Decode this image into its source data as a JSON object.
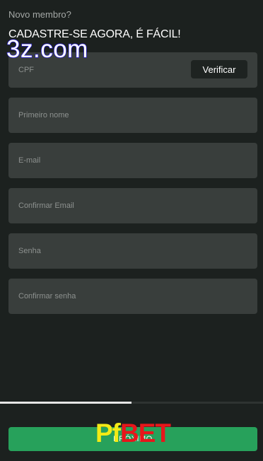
{
  "header": {
    "subtitle": "Novo membro?",
    "title": "CADASTRE-SE AGORA, É FÁCIL!"
  },
  "watermark": {
    "text": "3z.com"
  },
  "form": {
    "cpf_placeholder": "CPF",
    "verify_label": "Verificar",
    "first_name_placeholder": "Primeiro nome",
    "email_placeholder": "E-mail",
    "confirm_email_placeholder": "Confirmar Email",
    "password_placeholder": "Senha",
    "confirm_password_placeholder": "Confirmar senha"
  },
  "progress": {
    "fraction": 0.5
  },
  "footer": {
    "next_label": "PRÓXIMO"
  },
  "logo": {
    "part1": "Pf",
    "part2": "BET"
  },
  "colors": {
    "background": "#1c211f",
    "field": "#393e3c",
    "accent_green": "#27a15b",
    "logo_yellow": "#f3ea15",
    "logo_red": "#e8161b",
    "watermark_stroke": "#2a1fd6"
  }
}
